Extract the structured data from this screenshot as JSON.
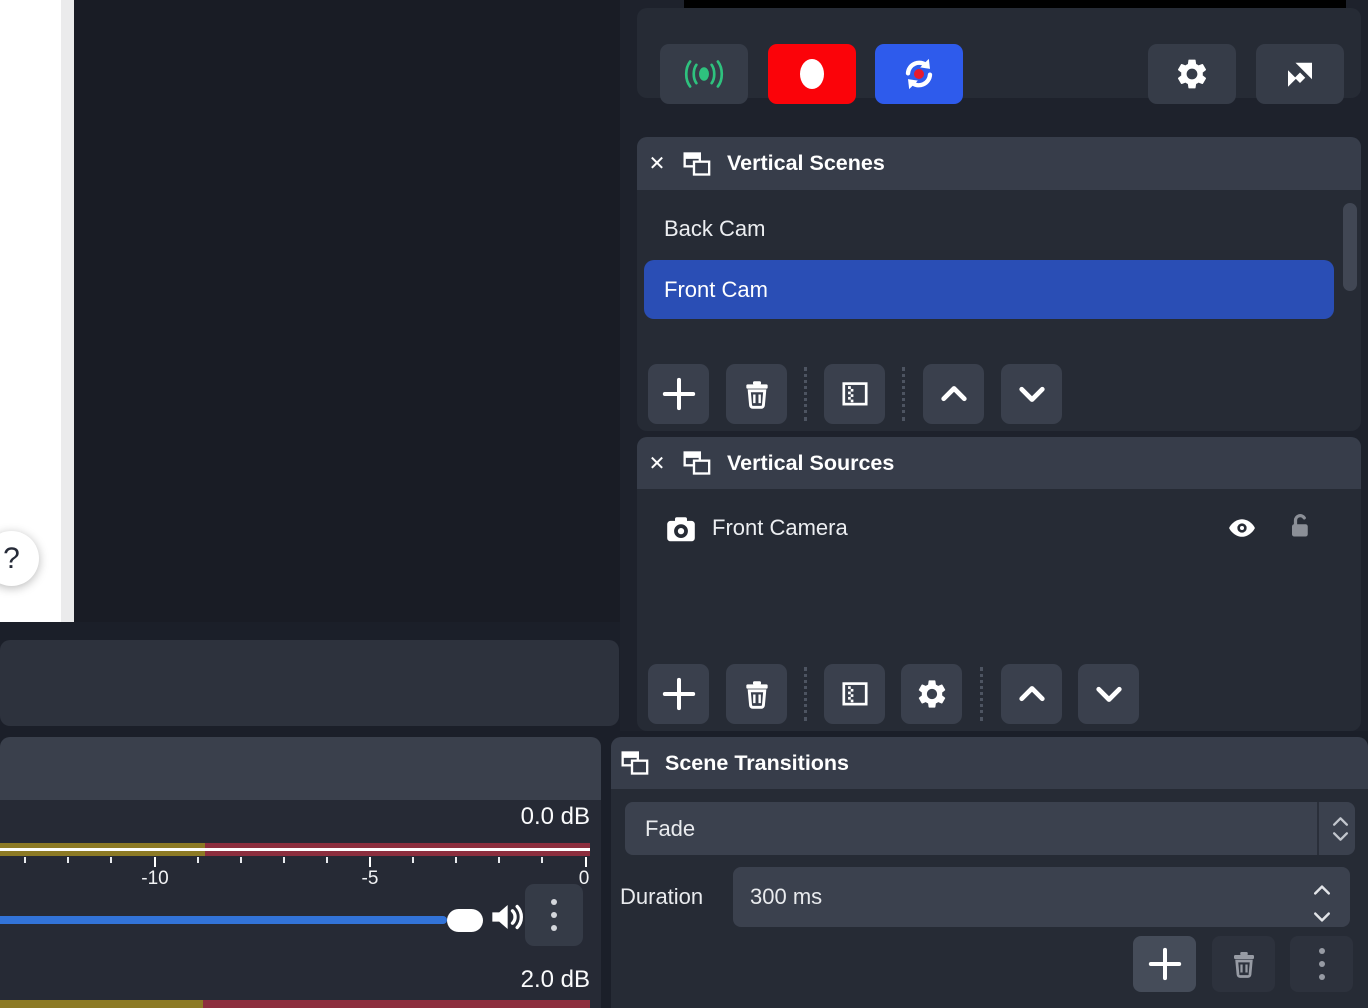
{
  "help_button": {
    "label": "?"
  },
  "controls": {
    "icons": [
      "broadcast-icon",
      "record-icon",
      "restart-icon",
      "gear-icon",
      "pop-out-icon"
    ]
  },
  "scenes_panel": {
    "title": "Vertical Scenes",
    "close_icon": "✕",
    "items": [
      {
        "label": "Back Cam",
        "selected": false
      },
      {
        "label": "Front Cam",
        "selected": true
      }
    ],
    "toolbar_icons": [
      "plus-icon",
      "trash-icon",
      "filter-icon",
      "chevron-up-icon",
      "chevron-down-icon"
    ]
  },
  "sources_panel": {
    "title": "Vertical Sources",
    "close_icon": "✕",
    "sources": [
      {
        "label": "Front Camera",
        "icon": "camera-icon",
        "visible": true,
        "locked": false
      }
    ],
    "toolbar_icons": [
      "plus-icon",
      "trash-icon",
      "filter-icon",
      "gear-icon",
      "chevron-up-icon",
      "chevron-down-icon"
    ]
  },
  "transitions_panel": {
    "title": "Scene Transitions",
    "transition_value": "Fade",
    "duration_label": "Duration",
    "duration_value": "300 ms"
  },
  "mixer": {
    "tracks": [
      {
        "db_label": "0.0 dB",
        "tick_labels": [
          "-10",
          "-5",
          "0"
        ]
      },
      {
        "db_label": "2.0 dB"
      }
    ]
  },
  "colors": {
    "selection_blue": "#2a4eb5",
    "record_red": "#fb0309",
    "action_blue": "#2e5bec",
    "live_green": "#2ec27e",
    "slider_blue": "#3273d8",
    "meter_yellow": "#8c7a25",
    "meter_red": "#8c2e3e"
  }
}
